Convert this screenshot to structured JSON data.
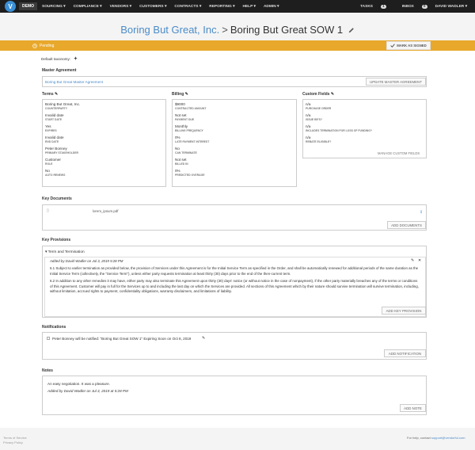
{
  "nav": {
    "logo": "V",
    "demo": "DEMO",
    "menu": [
      "SOURCING ▾",
      "COMPLIANCE ▾",
      "VENDORS ▾",
      "CUSTOMERS ▾",
      "CONTRACTS ▾",
      "REPORTING ▾",
      "HELP ▾",
      "ADMIN ▾"
    ],
    "tasks": "TASKS",
    "tasks_count": "1",
    "inbox": "INBOX",
    "inbox_count": "0",
    "user": "DAVID WADLER ▾"
  },
  "title": {
    "company": "Boring But Great, Inc.",
    "sep": ">",
    "sow": "Boring But Great SOW 1"
  },
  "status": {
    "label": "Pending",
    "mark_signed": "MARK AS SIGNED"
  },
  "taxonomy": "Default taxonomy:",
  "master": {
    "heading": "Master Agreement",
    "value": "Boring But Great Master Agreement",
    "button": "UPDATE MASTER AGREEMENT"
  },
  "terms": {
    "heading": "Terms",
    "fields": [
      {
        "v": "Boring But Great, Inc.",
        "l": "COUNTERPARTY"
      },
      {
        "v": "Invalid date",
        "l": "START DATE"
      },
      {
        "v": "Yes",
        "l": "EXPIRES"
      },
      {
        "v": "Invalid date",
        "l": "END DATE"
      },
      {
        "v": "Peter Bonney",
        "l": "PRIMARY STAKEHOLDER"
      },
      {
        "v": "Customer",
        "l": "ROLE"
      },
      {
        "v": "No",
        "l": "AUTO RENEWS"
      }
    ]
  },
  "billing": {
    "heading": "Billing",
    "fields": [
      {
        "v": "$9000",
        "l": "CONTRACTED AMOUNT"
      },
      {
        "v": "Not set",
        "l": "PAYMENT DUE"
      },
      {
        "v": "Monthly",
        "l": "BILLING FREQUENCY"
      },
      {
        "v": "0%",
        "l": "LATE PAYMENT INTEREST"
      },
      {
        "v": "No",
        "l": "CAN TERMINATE"
      },
      {
        "v": "Not set",
        "l": "BILLED IN"
      },
      {
        "v": "0%",
        "l": "PREDICTED OVERAGE"
      }
    ]
  },
  "custom": {
    "heading": "Custom Fields",
    "fields": [
      {
        "v": "n/a",
        "l": "PURCHASE ORDER"
      },
      {
        "v": "n/a",
        "l": "ISSUE BE'S?"
      },
      {
        "v": "n/a",
        "l": "INCLUDES TERMINATION FOR LOSS OF FUNDING?"
      },
      {
        "v": "n/a",
        "l": "REBATE ELIGIBLE?"
      }
    ],
    "button": "MANAGE CUSTOM FIELDS"
  },
  "docs": {
    "heading": "Key Documents",
    "file": "lorem_ipsum.pdf",
    "button": "ADD DOCUMENTS"
  },
  "provisions": {
    "heading": "Key Provisions",
    "section": "Term and Termination",
    "added": "Added by David Wadler on Jul 3, 2019 5:28 PM",
    "p1": "6.1 Subject to earlier termination as provided below, the provision of Services under this Agreement is for the Initial Service Term as specified in the Order, and shall be automatically renewed for additional periods of the same duration as the Initial Service Term (collectively, the \"Service Term\"), unless either party requests termination at least thirty (30) days prior to the end of the then-current term.",
    "p2": "6.2 In addition to any other remedies it may have, either party may also terminate this Agreement upon thirty (30) days' notice (or without notice in the case of nonpayment), if the other party materially breaches any of the terms or conditions of this Agreement. Customer will pay in full for the Services up to and including the last day on which the Services are provided. All sections of this Agreement which by their nature should survive termination will survive termination, including, without limitation, accrued rights to payment, confidentiality obligations, warranty disclaimers, and limitations of liability.",
    "button": "ADD KEY PROVISION"
  },
  "notifications": {
    "heading": "Notifications",
    "text": "Peter Bonney will be notified: \"Boring But Great SOW 1\" Expiring Soon on Oct 8, 2019",
    "button": "ADD NOTIFICATION"
  },
  "notes": {
    "heading": "Notes",
    "text": "An easy negotiation. It was a pleasure.",
    "added": "Added by David Wadler on Jul 3, 2019 at 5:28 PM",
    "button": "ADD NOTE"
  },
  "footer": {
    "terms": "Terms of Service",
    "privacy": "Privacy Policy",
    "help": "For help, contact",
    "email": "support@vendorful.com"
  },
  "colors": {
    "accent": "#4a8bc8",
    "status": "#e8a82b",
    "nav": "#1e1e1e"
  }
}
